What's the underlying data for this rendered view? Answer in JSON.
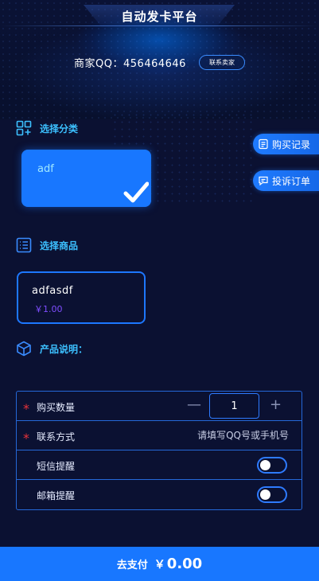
{
  "header": {
    "title": "自动发卡平台",
    "merchant_qq": "商家QQ：456464646",
    "contact_button": "联系卖家"
  },
  "side_buttons": {
    "purchase_records": "购买记录",
    "complaint_order": "投诉订单"
  },
  "category": {
    "label": "选择分类",
    "items": [
      {
        "name": "adf",
        "selected": true
      }
    ]
  },
  "product": {
    "label": "选择商品",
    "items": [
      {
        "name": "adfasdf",
        "price": "￥1.00"
      }
    ]
  },
  "description": {
    "label": "产品说明："
  },
  "form": {
    "quantity_label": "购买数量",
    "quantity_value": "1",
    "contact_label": "联系方式",
    "contact_placeholder": "请填写QQ号或手机号",
    "sms_label": "短信提醒",
    "email_label": "邮箱提醒",
    "required_mark": "*",
    "minus": "—",
    "plus": "+"
  },
  "pay": {
    "label": "去支付",
    "currency": "￥",
    "amount": "0.00"
  },
  "colors": {
    "accent": "#1877ff",
    "section_label": "#3cc0ff",
    "background": "#0b1132",
    "price": "#7f4dff",
    "required": "#e8333a"
  }
}
